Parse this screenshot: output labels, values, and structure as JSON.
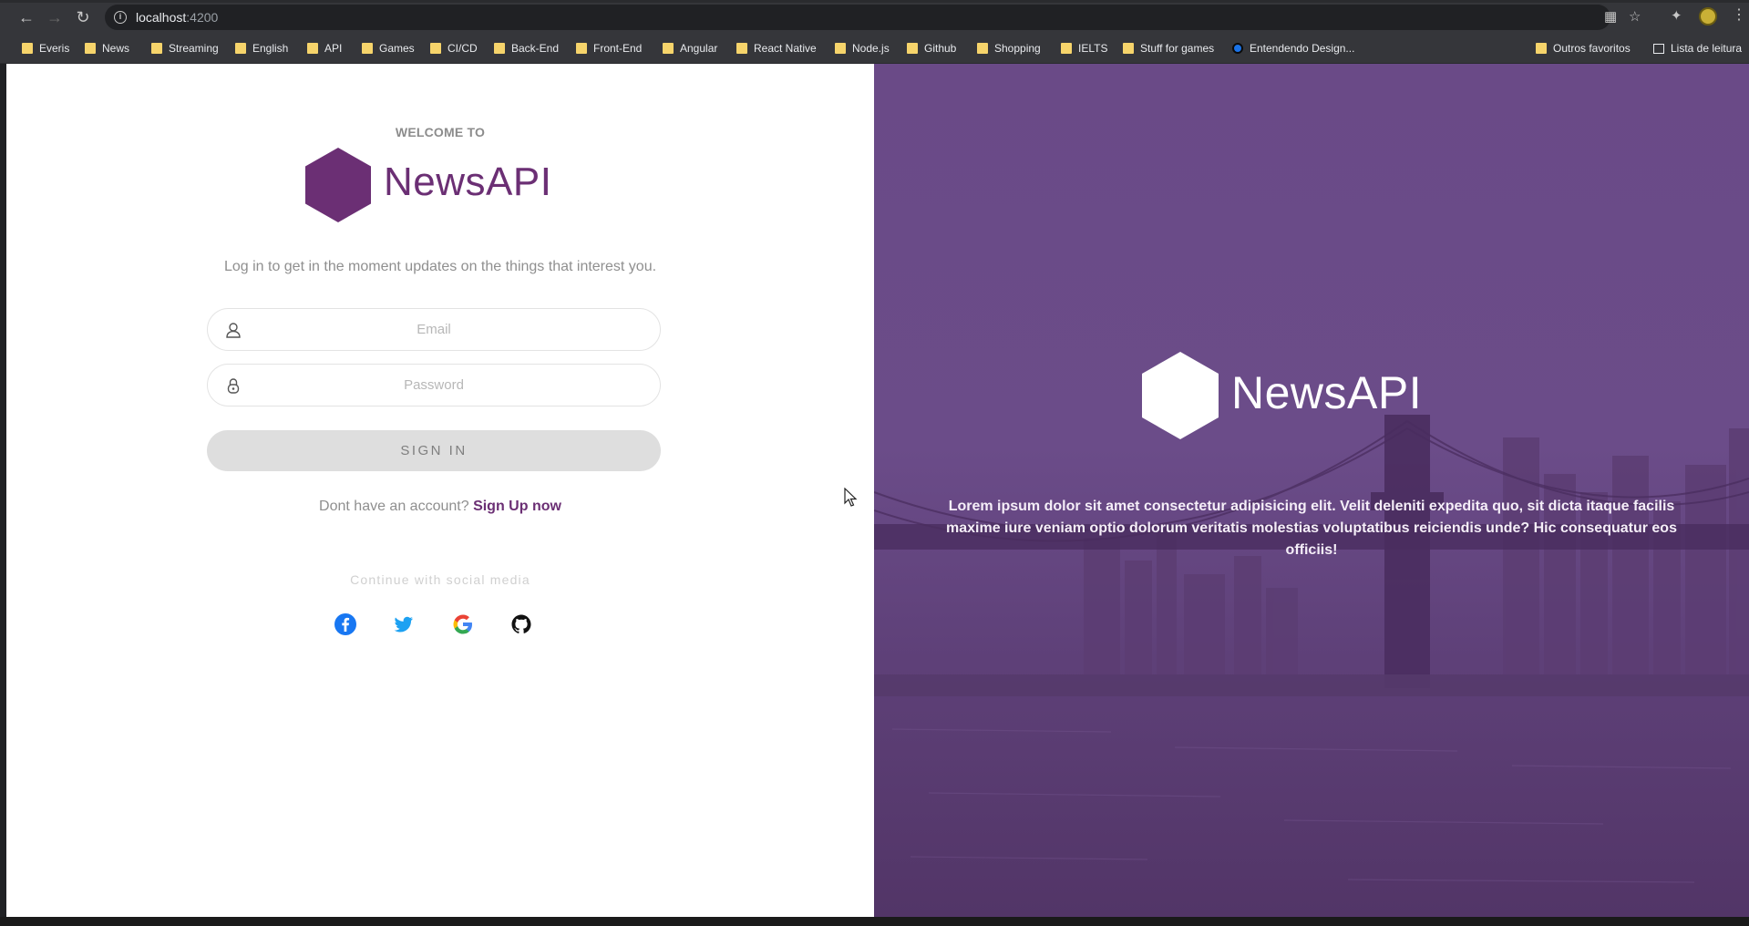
{
  "browser": {
    "url_host": "localhost",
    "url_port": ":4200",
    "bookmarks": [
      {
        "label": "Everis"
      },
      {
        "label": "News"
      },
      {
        "label": "Streaming"
      },
      {
        "label": "English"
      },
      {
        "label": "API"
      },
      {
        "label": "Games"
      },
      {
        "label": "CI/CD"
      },
      {
        "label": "Back-End"
      },
      {
        "label": "Front-End"
      },
      {
        "label": "Angular"
      },
      {
        "label": "React Native"
      },
      {
        "label": "Node.js"
      },
      {
        "label": "Github"
      },
      {
        "label": "Shopping"
      },
      {
        "label": "IELTS"
      },
      {
        "label": "Stuff for games"
      },
      {
        "label": "Entendendo Design..."
      }
    ],
    "other_bookmarks": "Outros favoritos",
    "reading_list": "Lista de leitura"
  },
  "login": {
    "welcome": "WELCOME TO",
    "brand": "NewsAPI",
    "tagline": "Log in to get in the moment updates on the things that interest you.",
    "email_placeholder": "Email",
    "password_placeholder": "Password",
    "signin_label": "SIGN IN",
    "signup_prompt": "Dont have an account?",
    "signup_link": "Sign Up now",
    "social_caption": "Continue with social media",
    "social": [
      "facebook-icon",
      "twitter-icon",
      "google-icon",
      "github-icon"
    ],
    "brand_color": "#6b2f74"
  },
  "hero": {
    "brand": "NewsAPI",
    "paragraph": "Lorem ipsum dolor sit amet consectetur adipisicing elit. Velit deleniti expedita quo, sit dicta itaque facilis maxime iure veniam optio dolorum veritatis molestias voluptatibus reiciendis unde? Hic consequatur eos officiis!",
    "overlay_color": "#6a4a87"
  }
}
